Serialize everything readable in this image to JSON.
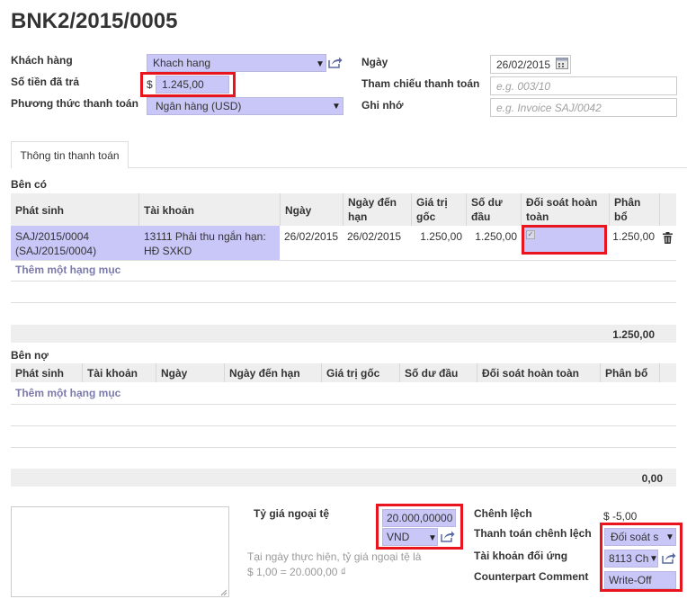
{
  "header": {
    "title": "BNK2/2015/0005"
  },
  "form": {
    "customer_label": "Khách hàng",
    "customer_value": "Khach hang",
    "amount_label": "Số tiền đã trả",
    "currency_symbol": "$",
    "amount_value": "1.245,00",
    "payment_method_label": "Phương thức thanh toán",
    "payment_method_value": "Ngân hàng (USD)",
    "date_label": "Ngày",
    "date_value": "26/02/2015",
    "reference_label": "Tham chiếu thanh toán",
    "reference_placeholder": "e.g. 003/10",
    "memo_label": "Ghi nhớ",
    "memo_placeholder": "e.g. Invoice SAJ/0042"
  },
  "tabs": [
    {
      "label": "Thông tin thanh toán"
    }
  ],
  "credit": {
    "title": "Bên có",
    "columns": {
      "origin": "Phát sinh",
      "account": "Tài khoản",
      "date": "Ngày",
      "due_l1": "Ngày đến",
      "due_l2": "hạn",
      "orig_l1": "Giá trị",
      "orig_l2": "gốc",
      "bal_l1": "Số dư",
      "bal_l2": "đầu",
      "rec_l1": "Đối soát hoàn",
      "rec_l2": "toàn",
      "alloc_l1": "Phân",
      "alloc_l2": "bổ"
    },
    "row": {
      "origin_l1": "SAJ/2015/0004",
      "origin_l2": "(SAJ/2015/0004)",
      "account_l1": "13111 Phải thu ngắn hạn:",
      "account_l2": "HĐ SXKD",
      "date": "26/02/2015",
      "due": "26/02/2015",
      "original": "1.250,00",
      "balance": "1.250,00",
      "allocation": "1.250,00"
    },
    "add_item": "Thêm một hạng mục",
    "total": "1.250,00"
  },
  "debit": {
    "title": "Bên nợ",
    "columns": {
      "origin": "Phát sinh",
      "account": "Tài khoản",
      "date": "Ngày",
      "due": "Ngày đến hạn",
      "original": "Giá trị gốc",
      "balance": "Số dư đầu",
      "reconcile": "Đối soát hoàn toàn",
      "allocation": "Phân bổ"
    },
    "add_item": "Thêm một hạng mục",
    "total": "0,00"
  },
  "bottom": {
    "rate_label": "Tỷ giá ngoại tệ",
    "rate_value": "20.000,00000",
    "rate_currency": "VND",
    "note_l1": "Tại ngày thực hiện, tỷ giá ngoại tệ là",
    "note_l2": "$ 1,00 = 20.000,00 ₫",
    "diff_label": "Chênh lệch",
    "diff_value": "$ -5,00",
    "diff_payment_label": "Thanh toán chênh lệch",
    "diff_payment_value": "Đối soát s",
    "diff_account_label": "Tài khoản đối ứng",
    "diff_account_value": "8113 Ch",
    "comment_label": "Counterpart Comment",
    "comment_value": "Write-Off"
  },
  "colors": {
    "highlight": "#c9c7f7",
    "red_outline": "#e8141e",
    "link": "#7c7bad"
  }
}
